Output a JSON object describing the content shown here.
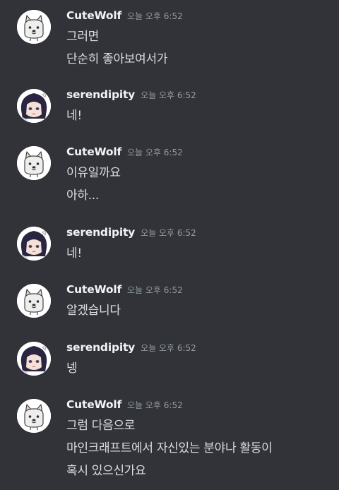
{
  "messages": [
    {
      "author": "CuteWolf",
      "avatar_icon": "wolf-avatar-icon",
      "timestamp": "오늘 오후 6:52",
      "lines": [
        "그러면",
        "단순히 좋아보여서가"
      ]
    },
    {
      "author": "serendipity",
      "avatar_icon": "anime-character-avatar-icon",
      "timestamp": "오늘 오후 6:52",
      "lines": [
        "네!"
      ]
    },
    {
      "author": "CuteWolf",
      "avatar_icon": "wolf-avatar-icon",
      "timestamp": "오늘 오후 6:52",
      "lines": [
        "이유일까요",
        "아하..."
      ]
    },
    {
      "author": "serendipity",
      "avatar_icon": "anime-character-avatar-icon",
      "timestamp": "오늘 오후 6:52",
      "lines": [
        "네!"
      ]
    },
    {
      "author": "CuteWolf",
      "avatar_icon": "wolf-avatar-icon",
      "timestamp": "오늘 오후 6:52",
      "lines": [
        "알겠습니다"
      ]
    },
    {
      "author": "serendipity",
      "avatar_icon": "anime-character-avatar-icon",
      "timestamp": "오늘 오후 6:52",
      "lines": [
        "넹"
      ]
    },
    {
      "author": "CuteWolf",
      "avatar_icon": "wolf-avatar-icon",
      "timestamp": "오늘 오후 6:52",
      "lines": [
        "그럼 다음으로",
        "마인크래프트에서 자신있는 분야나 활동이",
        "혹시 있으신가요"
      ]
    }
  ],
  "colors": {
    "background": "#313338",
    "username": "#f2f3f5",
    "timestamp": "#949ba4",
    "message_text": "#dbdee1"
  }
}
